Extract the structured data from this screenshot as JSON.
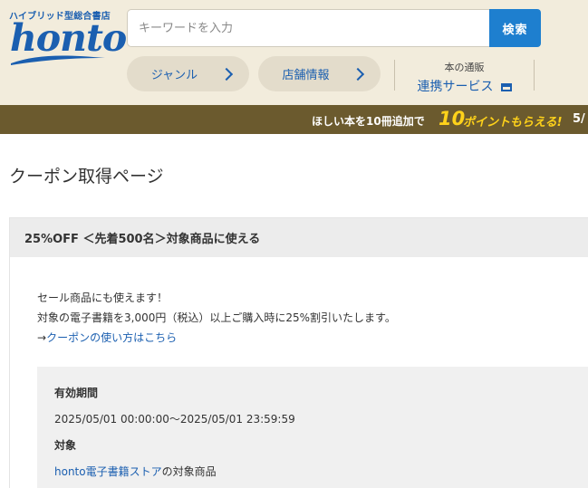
{
  "header": {
    "tagline": "ハイブリッド型総合書店",
    "logo": "honto",
    "search_placeholder": "キーワードを入力",
    "search_button": "検索",
    "nav": [
      {
        "label": "ジャンル"
      },
      {
        "label": "店舗情報"
      }
    ],
    "service": {
      "line1": "本の通販",
      "line2": "連携サービス"
    }
  },
  "promo": {
    "text": "ほしい本を10冊追加で",
    "number": "10",
    "highlight": "ポイントもらえる!",
    "trailing": "5/"
  },
  "page_title": "クーポン取得ページ",
  "coupon": {
    "title": "25%OFF ＜先着500名＞対象商品に使える",
    "line1": "セール商品にも使えます！",
    "line2": "対象の電子書籍を3,000円（税込）以上ご購入時に25%割引いたします。",
    "howto_prefix": "→",
    "howto_link": "クーポンの使い方はこちら",
    "validity_label": "有効期間",
    "validity_value": "2025/05/01 00:00:00〜2025/05/01 23:59:59",
    "target_label": "対象",
    "target_link": "honto電子書籍ストア",
    "target_suffix": "の対象商品"
  },
  "colors": {
    "brand_blue": "#1b5fb0",
    "search_button": "#1e7fcf",
    "header_bg": "#f2ecdc",
    "promo_bg": "#6b5a2e",
    "promo_accent": "#ffd21a"
  }
}
